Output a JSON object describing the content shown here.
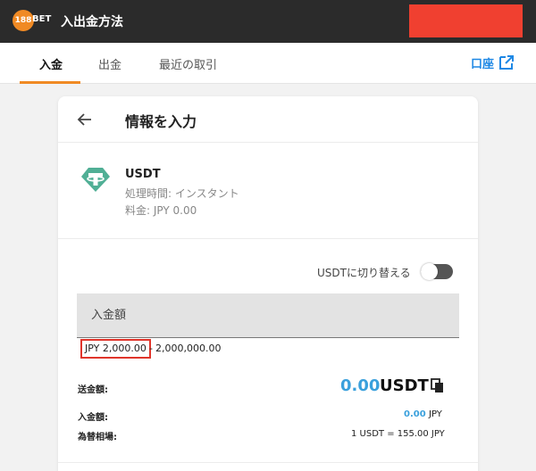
{
  "header": {
    "logo_number": "188",
    "logo_text": "BET",
    "title": "入出金方法"
  },
  "tabs": [
    {
      "label": "入金",
      "active": true
    },
    {
      "label": "出金",
      "active": false
    },
    {
      "label": "最近の取引",
      "active": false
    }
  ],
  "account": {
    "label": "口座",
    "icon": "external-link-icon"
  },
  "card": {
    "title": "情報を入力",
    "back_icon": "arrow-left-icon"
  },
  "coin": {
    "name": "USDT",
    "icon": "tether-icon",
    "processing_time": "処理時間: インスタント",
    "fee": "料金: JPY 0.00"
  },
  "switch": {
    "label": "USDTに切り替える",
    "on": false
  },
  "amount": {
    "placeholder": "入金額",
    "range_min": "JPY 2,000.00",
    "range_sep": "-",
    "range_max": "2,000,000.00"
  },
  "summary": {
    "send_label": "送金額:",
    "send_value": "0.00",
    "send_unit": "USDT",
    "deposit_label": "入金額:",
    "deposit_value": "0.00",
    "deposit_unit": "JPY",
    "rate_label": "為替相場:",
    "rate_value": "1 USDT = 155.00 JPY"
  },
  "colors": {
    "accent": "#f08a24",
    "link": "#1e88e5",
    "amount": "#3aa0dc",
    "highlight": "#e0352b"
  }
}
